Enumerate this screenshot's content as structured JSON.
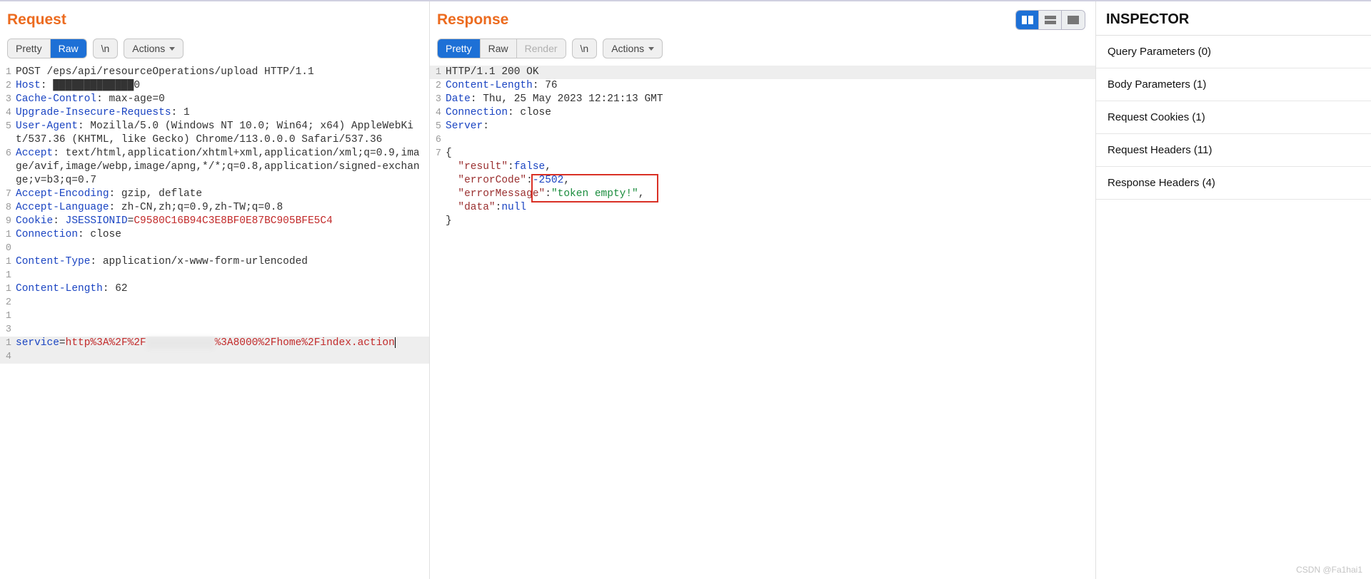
{
  "request": {
    "title": "Request",
    "toolbar": {
      "pretty": "Pretty",
      "raw": "Raw",
      "newline": "\\n",
      "actions": "Actions"
    },
    "active_tab": "raw",
    "lines": [
      {
        "n": 1,
        "type": "plain",
        "text": "POST /eps/api/resourceOperations/upload HTTP/1.1"
      },
      {
        "n": 2,
        "type": "header",
        "key": "Host",
        "value": "█████████████0"
      },
      {
        "n": 3,
        "type": "header",
        "key": "Cache-Control",
        "value": "max-age=0"
      },
      {
        "n": 4,
        "type": "header",
        "key": "Upgrade-Insecure-Requests",
        "value": "1"
      },
      {
        "n": 5,
        "type": "header",
        "key": "User-Agent",
        "value": "Mozilla/5.0 (Windows NT 10.0; Win64; x64) AppleWebKit/537.36 (KHTML, like Gecko) Chrome/113.0.0.0 Safari/537.36"
      },
      {
        "n": 6,
        "type": "header",
        "key": "Accept",
        "value": "text/html,application/xhtml+xml,application/xml;q=0.9,image/avif,image/webp,image/apng,*/*;q=0.8,application/signed-exchange;v=b3;q=0.7"
      },
      {
        "n": 7,
        "type": "header",
        "key": "Accept-Encoding",
        "value": "gzip, deflate"
      },
      {
        "n": 8,
        "type": "header",
        "key": "Accept-Language",
        "value": "zh-CN,zh;q=0.9,zh-TW;q=0.8"
      },
      {
        "n": 9,
        "type": "cookie",
        "key": "Cookie",
        "ckey": "JSESSIONID",
        "cval": "C9580C16B94C3E8BF0E87BC905BFE5C4"
      },
      {
        "n": 10,
        "type": "header",
        "key": "Connection",
        "value": "close"
      },
      {
        "n": 11,
        "type": "header",
        "key": "Content-Type",
        "value": "application/x-www-form-urlencoded"
      },
      {
        "n": 12,
        "type": "header",
        "key": "Content-Length",
        "value": "62"
      },
      {
        "n": 13,
        "type": "blank"
      },
      {
        "n": 14,
        "type": "param",
        "pkey": "service",
        "prefix": "http%3A%2F%2F",
        "obscured": "███████████",
        "suffix": "%3A8000%2Fhome%2Findex.action"
      }
    ]
  },
  "response": {
    "title": "Response",
    "toolbar": {
      "pretty": "Pretty",
      "raw": "Raw",
      "render": "Render",
      "newline": "\\n",
      "actions": "Actions"
    },
    "active_tab": "pretty",
    "lines": [
      {
        "n": 1,
        "type": "plain",
        "text": "HTTP/1.1 200 OK"
      },
      {
        "n": 2,
        "type": "header",
        "key": "Content-Length",
        "value": "76"
      },
      {
        "n": 3,
        "type": "header",
        "key": "Date",
        "value": "Thu, 25 May 2023 12:21:13 GMT"
      },
      {
        "n": 4,
        "type": "header",
        "key": "Connection",
        "value": "close"
      },
      {
        "n": 5,
        "type": "header",
        "key": "Server",
        "value": ""
      },
      {
        "n": 6,
        "type": "blank"
      },
      {
        "n": 7,
        "type": "json"
      }
    ],
    "json_body": {
      "result": false,
      "errorCode": -2502,
      "errorMessage": "token empty!",
      "data": null
    }
  },
  "inspector": {
    "title": "INSPECTOR",
    "items": [
      {
        "label": "Query Parameters",
        "count": 0
      },
      {
        "label": "Body Parameters",
        "count": 1
      },
      {
        "label": "Request Cookies",
        "count": 1
      },
      {
        "label": "Request Headers",
        "count": 11
      },
      {
        "label": "Response Headers",
        "count": 4
      }
    ]
  },
  "watermark": "CSDN @Fa1hai1"
}
